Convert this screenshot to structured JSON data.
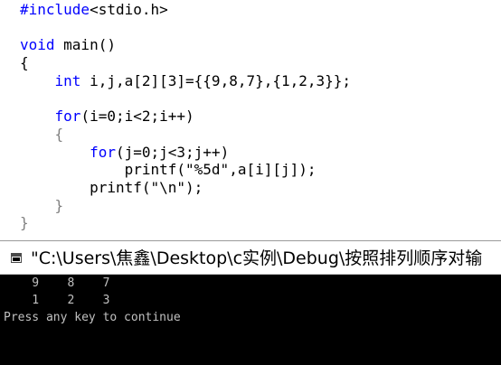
{
  "editor": {
    "lines": [
      {
        "parts": [
          {
            "t": "#include",
            "c": "pp"
          },
          {
            "t": "<stdio.h>",
            "c": "code"
          }
        ]
      },
      {
        "parts": []
      },
      {
        "parts": [
          {
            "t": "void",
            "c": "kw"
          },
          {
            "t": " main()",
            "c": "code"
          }
        ]
      },
      {
        "parts": [
          {
            "t": "{",
            "c": "code"
          }
        ]
      },
      {
        "parts": [
          {
            "t": "    ",
            "c": "code"
          },
          {
            "t": "int",
            "c": "kw"
          },
          {
            "t": " i,j,a[2][3]={{9,8,7},{1,2,3}};",
            "c": "code"
          }
        ]
      },
      {
        "parts": []
      },
      {
        "parts": [
          {
            "t": "    ",
            "c": "code"
          },
          {
            "t": "for",
            "c": "kw"
          },
          {
            "t": "(i=0;i<2;i++)",
            "c": "code"
          }
        ]
      },
      {
        "parts": [
          {
            "t": "    {",
            "c": "bracket"
          }
        ]
      },
      {
        "parts": [
          {
            "t": "        ",
            "c": "code"
          },
          {
            "t": "for",
            "c": "kw"
          },
          {
            "t": "(j=0;j<3;j++)",
            "c": "code"
          }
        ]
      },
      {
        "parts": [
          {
            "t": "            printf(\"%5d\",a[i][j]);",
            "c": "code"
          }
        ]
      },
      {
        "parts": [
          {
            "t": "        printf(\"\\n\");",
            "c": "code"
          }
        ]
      },
      {
        "parts": [
          {
            "t": "    }",
            "c": "bracket"
          }
        ]
      },
      {
        "parts": [
          {
            "t": "}",
            "c": "bracket"
          }
        ]
      }
    ]
  },
  "console": {
    "title": "\"C:\\Users\\焦鑫\\Desktop\\c实例\\Debug\\按照排列顺序对输",
    "icon": "console-window-icon",
    "output": [
      "    9    8    7",
      "    1    2    3",
      "Press any key to continue"
    ]
  },
  "colors": {
    "keyword": "#0000ff",
    "code": "#000000",
    "bracket": "#808080",
    "console_bg": "#000000",
    "console_text": "#c0c0c0"
  }
}
